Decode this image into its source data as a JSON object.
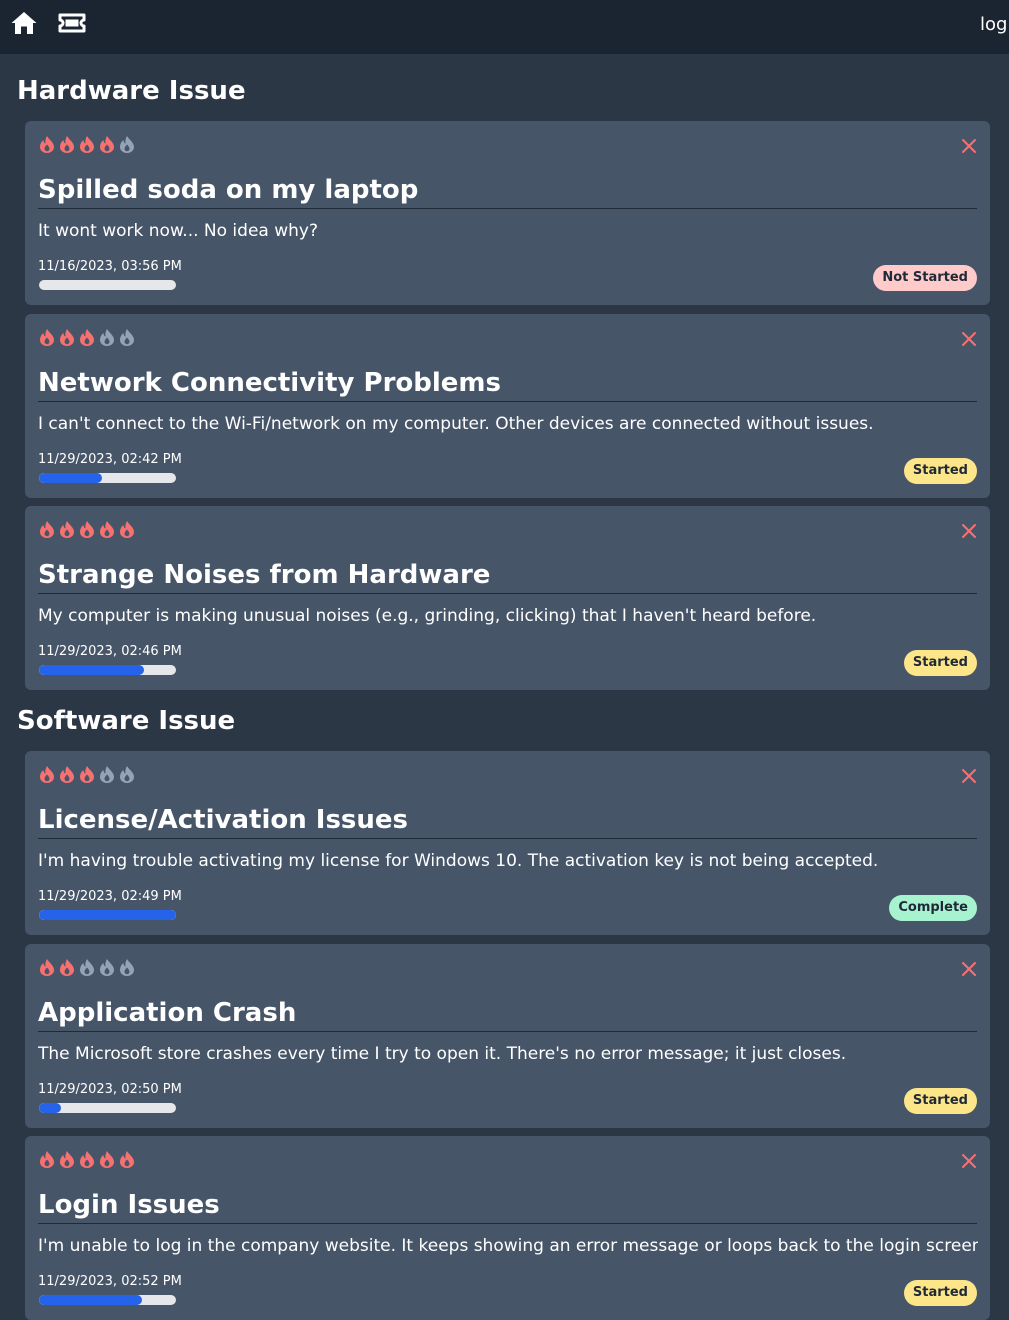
{
  "nav": {
    "home_icon": "home-icon",
    "tickets_icon": "ticket-icon",
    "login_label": "login"
  },
  "colors": {
    "page_bg": "#2c3746",
    "topbar_bg": "#1b2431",
    "card_bg": "#475569",
    "flame_active": "#f87171",
    "flame_inactive": "#94a3b8",
    "close": "#f87171",
    "progress_fill": "#2563eb",
    "progress_track": "#e5e7eb",
    "status": {
      "Not Started": "#fecaca",
      "Started": "#fde68a",
      "Complete": "#a7f3d0"
    }
  },
  "sections": [
    {
      "title": "Hardware Issue",
      "tickets": [
        {
          "priority": 4,
          "title": "Spilled soda on my laptop",
          "description": "It wont work now... No idea why?",
          "date": "11/16/2023, 03:56 PM",
          "progress": 0,
          "status": "Not Started"
        },
        {
          "priority": 3,
          "title": "Network Connectivity Problems",
          "description": "I can't connect to the Wi-Fi/network on my computer. Other devices are connected without issues.",
          "date": "11/29/2023, 02:42 PM",
          "progress": 0.46,
          "status": "Started"
        },
        {
          "priority": 5,
          "title": "Strange Noises from Hardware",
          "description": "My computer is making unusual noises (e.g., grinding, clicking) that I haven't heard before.",
          "date": "11/29/2023, 02:46 PM",
          "progress": 0.77,
          "status": "Started"
        }
      ]
    },
    {
      "title": "Software Issue",
      "tickets": [
        {
          "priority": 3,
          "title": "License/Activation Issues",
          "description": "I'm having trouble activating my license for Windows 10. The activation key is not being accepted.",
          "date": "11/29/2023, 02:49 PM",
          "progress": 1,
          "status": "Complete"
        },
        {
          "priority": 2,
          "title": "Application Crash",
          "description": "The Microsoft store crashes every time I try to open it. There's no error message; it just closes.",
          "date": "11/29/2023, 02:50 PM",
          "progress": 0.16,
          "status": "Started"
        },
        {
          "priority": 5,
          "title": "Login Issues",
          "description": "I'm unable to log in the company website. It keeps showing an error message or loops back to the login screen.",
          "date": "11/29/2023, 02:52 PM",
          "progress": 0.75,
          "status": "Started"
        }
      ]
    }
  ]
}
